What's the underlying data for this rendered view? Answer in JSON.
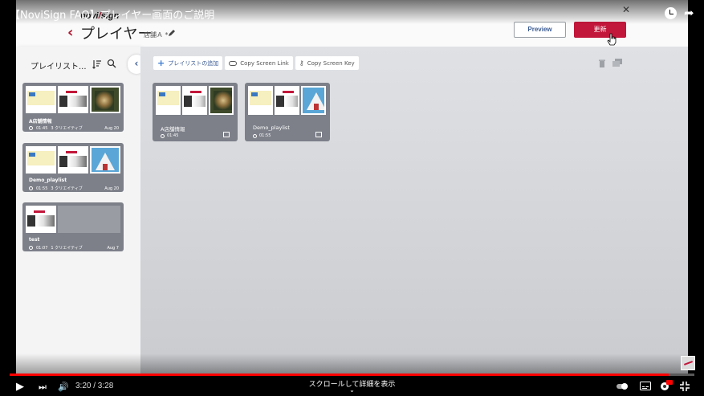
{
  "video": {
    "title": "【NoviSign FAQ】プレイヤー画面のご説明",
    "time": "3:20 / 3:28",
    "progress_fraction": 0.962,
    "scroll_hint": "スクロールして詳細を表示",
    "scroll_chevron": "⌄"
  },
  "app": {
    "logo_pre": "novi",
    "logo_slash": "/",
    "logo_post": "sign",
    "back_symbol": "‹",
    "title": "プレイヤー",
    "store": "店舗Ａ *",
    "preview_label": "Preview",
    "update_label": "更新"
  },
  "sidebar": {
    "title": "プレイリスト...",
    "collapse_symbol": "‹",
    "playlists": [
      {
        "name": "A店舗情報",
        "duration": "01:45",
        "count": "3 クリエイティブ",
        "date": "Aug 20",
        "thumbs": [
          "t-a",
          "t-b",
          "t-c"
        ]
      },
      {
        "name": "Demo_playlist",
        "duration": "01:55",
        "count": "3 クリエイティブ",
        "date": "Aug 20",
        "thumbs": [
          "t-a",
          "t-b",
          "t-d"
        ]
      },
      {
        "name": "test",
        "duration": "01:07",
        "count": "1 クリエイティブ",
        "date": "Aug 7",
        "thumbs": [
          "t-b"
        ]
      }
    ]
  },
  "toolbar": {
    "add_playlist": "プレイリストの追加",
    "copy_link": "Copy Screen Link",
    "copy_key": "Copy Screen Key",
    "plus_symbol": "+",
    "key_symbol": "⚷"
  },
  "assigned": [
    {
      "name": "A店舗情報",
      "duration": "01:45",
      "thumbs": [
        "t-a",
        "t-b",
        "t-c"
      ]
    },
    {
      "name": "Demo_playlist",
      "duration": "01:55",
      "thumbs": [
        "t-a",
        "t-b",
        "t-d"
      ]
    }
  ],
  "controls": {
    "play": "▶",
    "next": "⏭",
    "volume": "🔊"
  }
}
